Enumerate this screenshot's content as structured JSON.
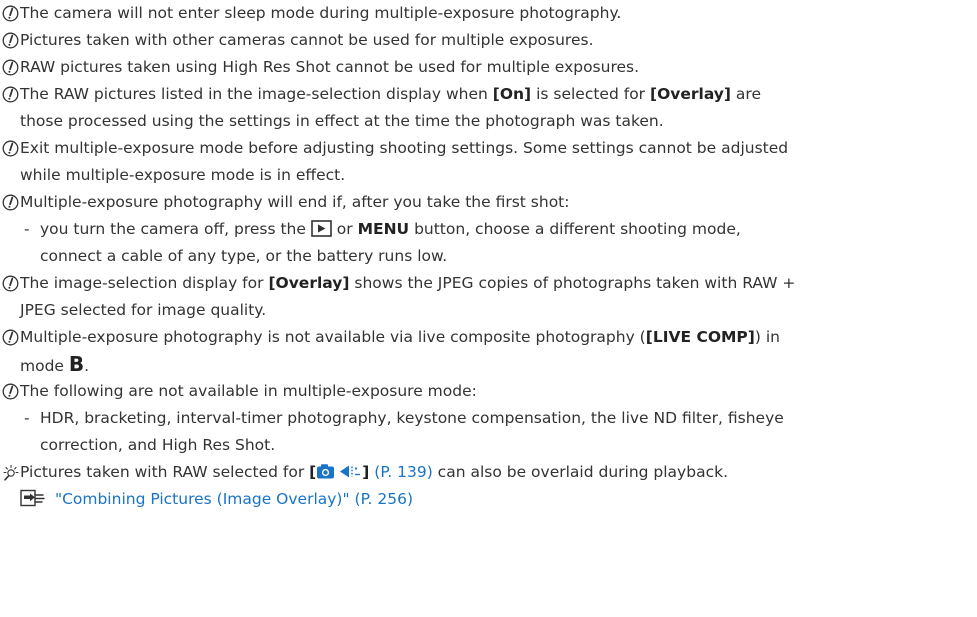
{
  "notes": [
    {
      "text": "The camera will not enter sleep mode during multiple-exposure photography."
    },
    {
      "text": "Pictures taken with other cameras cannot be used for multiple exposures."
    },
    {
      "text": "RAW pictures taken using High Res Shot cannot be used for multiple exposures."
    },
    {
      "pre1": "The RAW pictures listed in the image-selection display when ",
      "b1": "[On]",
      "pre2": " is selected for ",
      "b2": "[Overlay]",
      "pre3": " are",
      "line2": "those processed using the settings in effect at the time the photograph was taken."
    },
    {
      "line1": "Exit multiple-exposure mode before adjusting shooting settings. Some settings cannot be adjusted",
      "line2": "while multiple-exposure mode is in effect."
    },
    {
      "text": "Multiple-exposure photography will end if, after you take the first shot:",
      "sub_pre": "you turn the camera off, press the ",
      "sub_mid": " or ",
      "sub_btn": "MENU",
      "sub_post": " button, choose a different shooting mode,",
      "sub_line2": "connect a cable of any type, or the battery runs low."
    },
    {
      "pre1": "The image-selection display for ",
      "b1": "[Overlay]",
      "pre2": " shows the JPEG copies of photographs taken with RAW +",
      "line2": "JPEG selected for image quality."
    },
    {
      "pre1": "Multiple-exposure photography is not available via live composite photography (",
      "b1": "[LIVE COMP]",
      "pre2": ") in",
      "line2_pre": "mode ",
      "line2_b": "B",
      "line2_post": "."
    },
    {
      "text": "The following are not available in multiple-exposure mode:",
      "sub_line1": "HDR, bracketing, interval-timer photography, keystone compensation, the live ND filter, fisheye",
      "sub_line2": "correction, and High Res Shot."
    }
  ],
  "tip": {
    "pre": "Pictures taken with RAW selected for ",
    "bracket_open": "[",
    "bracket_close": "]",
    "page_ref": "(P. 139)",
    "post": " can also be overlaid during playback."
  },
  "reference": {
    "link_text": "\"Combining Pictures (Image Overlay)\" (P. 256)"
  },
  "sub_dash": "-"
}
